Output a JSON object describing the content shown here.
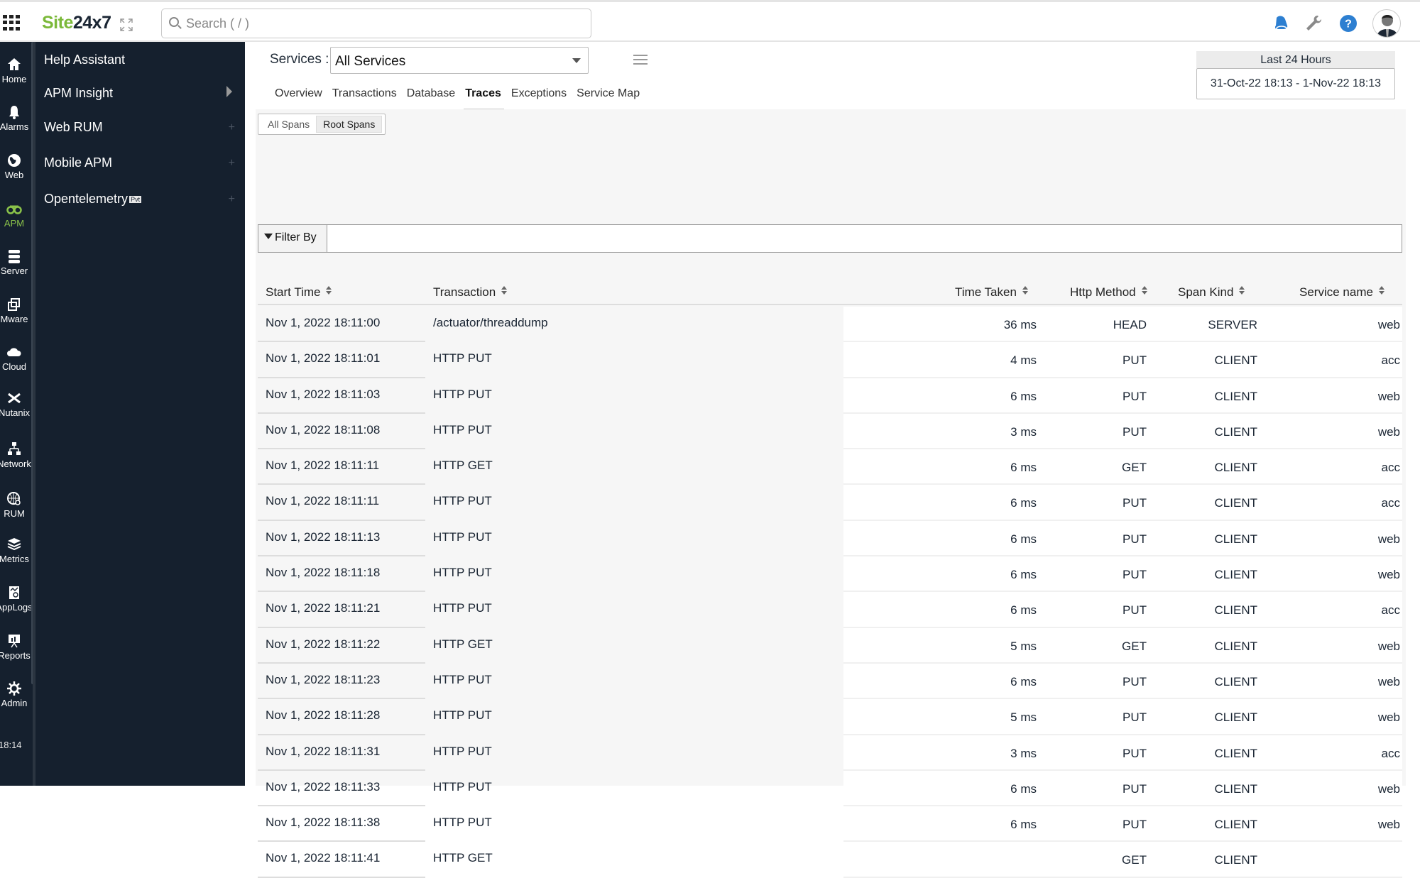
{
  "app": {
    "brand_part1": "Site",
    "brand_part2": "24x7"
  },
  "search": {
    "placeholder": "Search ( / )"
  },
  "top_icons": [
    "notifications-bell",
    "tools-wrench",
    "help-question",
    "user-avatar"
  ],
  "rail": {
    "items": [
      {
        "label": "Home",
        "icon": "home-icon"
      },
      {
        "label": "Alarms",
        "icon": "bell-icon"
      },
      {
        "label": "Web",
        "icon": "globe-icon"
      },
      {
        "label": "APM",
        "icon": "binoculars-icon",
        "active": true
      },
      {
        "label": "Server",
        "icon": "server-icon"
      },
      {
        "label": "Mware",
        "icon": "layers-icon"
      },
      {
        "label": "Cloud",
        "icon": "cloud-icon"
      },
      {
        "label": "Nutanix",
        "icon": "nutanix-icon"
      },
      {
        "label": "Network",
        "icon": "network-icon"
      },
      {
        "label": "RUM",
        "icon": "rum-globe-icon"
      },
      {
        "label": "Metrics",
        "icon": "stack-icon"
      },
      {
        "label": "AppLogs",
        "icon": "applogs-icon"
      },
      {
        "label": "Reports",
        "icon": "report-board-icon"
      },
      {
        "label": "Admin",
        "icon": "gear-icon"
      }
    ],
    "time": "18:14"
  },
  "subnav": {
    "items": [
      {
        "label": "Help Assistant"
      },
      {
        "label": "APM Insight",
        "has_arrow": true
      },
      {
        "label": "Web RUM",
        "has_add": true
      },
      {
        "label": "Mobile APM",
        "has_add": true
      },
      {
        "label": "Opentelemetry",
        "badge": "Pvt",
        "has_add": true
      }
    ]
  },
  "services": {
    "label": "Services :",
    "selected": "All Services"
  },
  "tabs": [
    {
      "label": "Overview"
    },
    {
      "label": "Transactions"
    },
    {
      "label": "Database"
    },
    {
      "label": "Traces",
      "active": true
    },
    {
      "label": "Exceptions"
    },
    {
      "label": "Service Map"
    }
  ],
  "daterange": {
    "preset": "Last 24 Hours",
    "range": "31-Oct-22 18:13 - 1-Nov-22 18:13"
  },
  "span_toggle": {
    "all": "All Spans",
    "root": "Root Spans",
    "active": "root"
  },
  "filter": {
    "label": "Filter By",
    "value": ""
  },
  "table": {
    "columns": [
      "Start Time",
      "Transaction",
      "Time Taken",
      "Http Method",
      "Span Kind",
      "Service name"
    ],
    "rows": [
      [
        "Nov 1, 2022 18:11:00",
        "/actuator/threaddump",
        "36 ms",
        "HEAD",
        "SERVER",
        "web"
      ],
      [
        "Nov 1, 2022 18:11:01",
        "HTTP PUT",
        "4 ms",
        "PUT",
        "CLIENT",
        "acc"
      ],
      [
        "Nov 1, 2022 18:11:03",
        "HTTP PUT",
        "6 ms",
        "PUT",
        "CLIENT",
        "web"
      ],
      [
        "Nov 1, 2022 18:11:08",
        "HTTP PUT",
        "3 ms",
        "PUT",
        "CLIENT",
        "web"
      ],
      [
        "Nov 1, 2022 18:11:11",
        "HTTP GET",
        "6 ms",
        "GET",
        "CLIENT",
        "acc"
      ],
      [
        "Nov 1, 2022 18:11:11",
        "HTTP PUT",
        "6 ms",
        "PUT",
        "CLIENT",
        "acc"
      ],
      [
        "Nov 1, 2022 18:11:13",
        "HTTP PUT",
        "6 ms",
        "PUT",
        "CLIENT",
        "web"
      ],
      [
        "Nov 1, 2022 18:11:18",
        "HTTP PUT",
        "6 ms",
        "PUT",
        "CLIENT",
        "web"
      ],
      [
        "Nov 1, 2022 18:11:21",
        "HTTP PUT",
        "6 ms",
        "PUT",
        "CLIENT",
        "acc"
      ],
      [
        "Nov 1, 2022 18:11:22",
        "HTTP GET",
        "5 ms",
        "GET",
        "CLIENT",
        "web"
      ],
      [
        "Nov 1, 2022 18:11:23",
        "HTTP PUT",
        "6 ms",
        "PUT",
        "CLIENT",
        "web"
      ],
      [
        "Nov 1, 2022 18:11:28",
        "HTTP PUT",
        "5 ms",
        "PUT",
        "CLIENT",
        "web"
      ],
      [
        "Nov 1, 2022 18:11:31",
        "HTTP PUT",
        "3 ms",
        "PUT",
        "CLIENT",
        "acc"
      ],
      [
        "Nov 1, 2022 18:11:33",
        "HTTP PUT",
        "6 ms",
        "PUT",
        "CLIENT",
        "web"
      ],
      [
        "Nov 1, 2022 18:11:38",
        "HTTP PUT",
        "6 ms",
        "PUT",
        "CLIENT",
        "web"
      ],
      [
        "Nov 1, 2022 18:11:41",
        "HTTP GET",
        "",
        "GET",
        "CLIENT",
        ""
      ]
    ]
  },
  "colors": {
    "brand_green": "#7bb93a",
    "sidebar_bg": "#15202e",
    "accent_blue": "#2d7fd1",
    "active_rail": "#8bc34a"
  }
}
